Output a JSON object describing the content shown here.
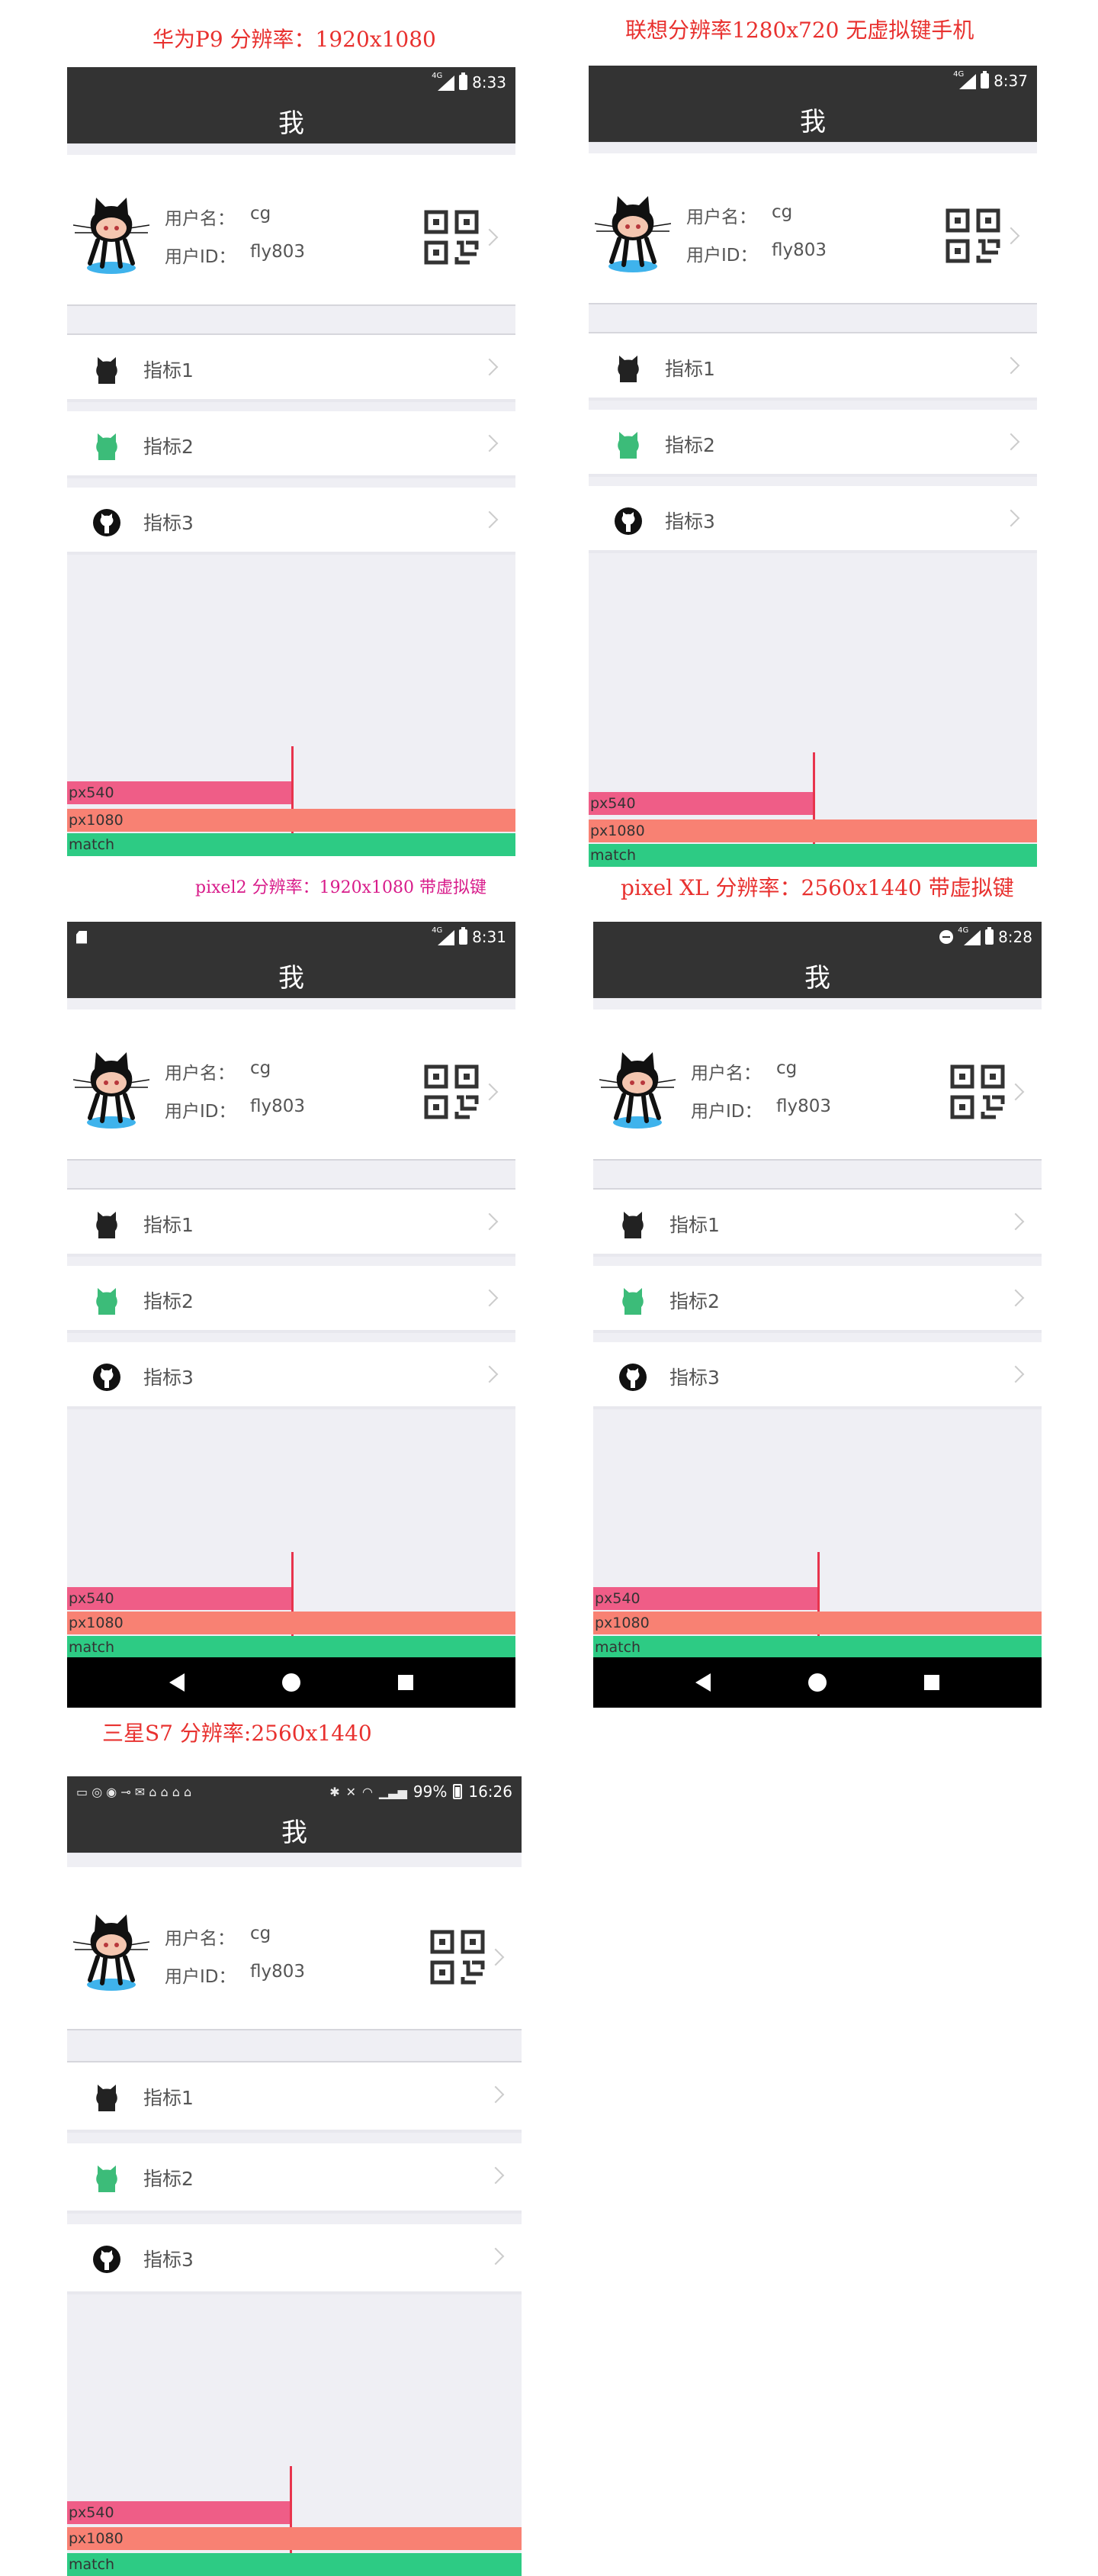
{
  "captions": {
    "huawei": "华为P9 分辨率：1920x1080",
    "lenovo": "联想分辨率1280x720 无虚拟键手机",
    "pixel2": "pixel2 分辨率：1920x1080 带虚拟键",
    "pixelxl": "pixel XL 分辨率：2560x1440 带虚拟键",
    "samsung": "三星S7 分辨率:2560x1440"
  },
  "caption_colors": {
    "red": "#e8312f",
    "magenta": "#d81b8a"
  },
  "network_label": "4G",
  "phones": {
    "huawei": {
      "time": "8:33"
    },
    "lenovo": {
      "time": "8:37"
    },
    "pixel2": {
      "time": "8:31"
    },
    "pixelxl": {
      "time": "8:28"
    },
    "samsung": {
      "time": "16:26",
      "battery": "99%"
    }
  },
  "app": {
    "title": "我",
    "username_label": "用户名：",
    "username_value": "cg",
    "userid_label": "用户ID：",
    "userid_value": "fly803",
    "rows": [
      {
        "label": "指标1",
        "icon": "github-octocat-black-icon"
      },
      {
        "label": "指标2",
        "icon": "github-octocat-green-icon"
      },
      {
        "label": "指标3",
        "icon": "github-mark-icon"
      }
    ],
    "bars": {
      "px540": "px540",
      "px1080": "px1080",
      "match": "match"
    },
    "bar_colors": {
      "px540": "#ef5d87",
      "px1080": "#f88173",
      "match": "#2dcb84",
      "line": "#e8344d"
    }
  }
}
